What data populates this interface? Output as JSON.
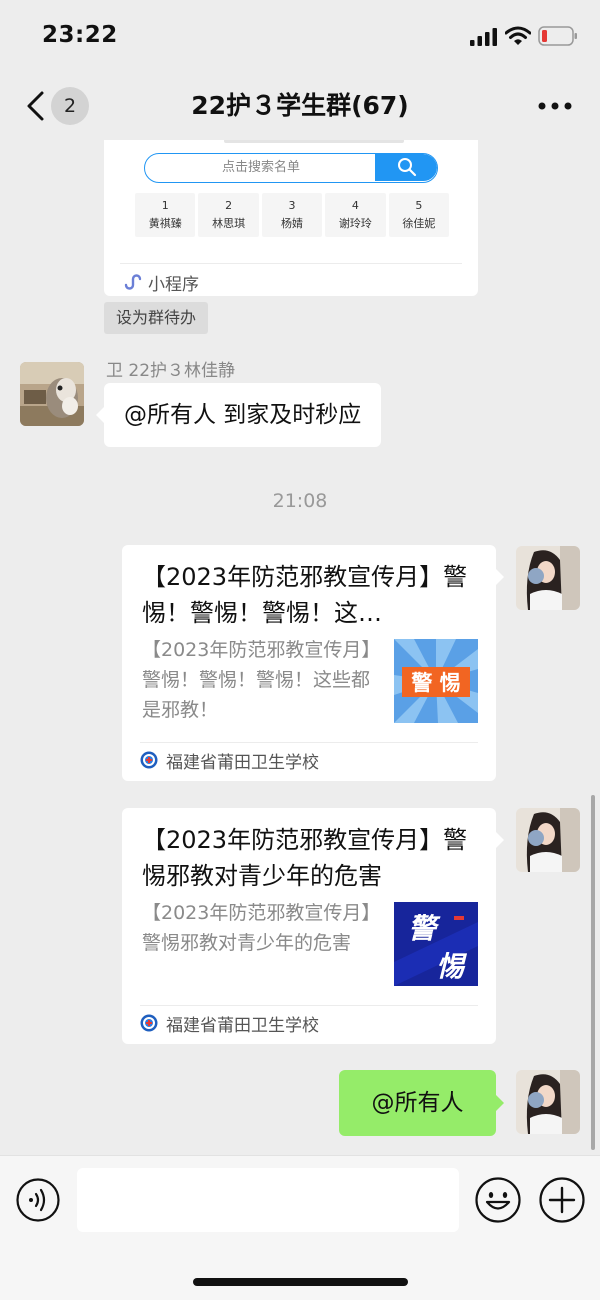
{
  "status_bar": {
    "time": "23:22"
  },
  "header": {
    "unread_count": "2",
    "title": "22护３学生群(67)"
  },
  "mini_program": {
    "search_placeholder": "点击搜索名单",
    "names": [
      {
        "index": "1",
        "name": "黄祺臻"
      },
      {
        "index": "2",
        "name": "林思琪"
      },
      {
        "index": "3",
        "name": "杨婧"
      },
      {
        "index": "4",
        "name": "谢玲玲"
      },
      {
        "index": "5",
        "name": "徐佳妮"
      }
    ],
    "footer_label": "小程序"
  },
  "todo_tag": "设为群待办",
  "incoming_message": {
    "sender": "卫 22护３林佳静",
    "text": "@所有人 到家及时秒应"
  },
  "time_divider": "21:08",
  "articles": [
    {
      "title": "【2023年防范邪教宣传月】警惕！警惕！警惕！这…",
      "desc": "【2023年防范邪教宣传月】警惕！警惕！警惕！这些都是邪教！",
      "thumb_text": "警 惕",
      "source": "福建省莆田卫生学校"
    },
    {
      "title": "【2023年防范邪教宣传月】警惕邪教对青少年的危害",
      "desc": "【2023年防范邪教宣传月】警惕邪教对青少年的危害",
      "thumb_text_1": "警",
      "thumb_text_2": "惕",
      "source": "福建省莆田卫生学校"
    }
  ],
  "outgoing_message": {
    "text": "@所有人"
  },
  "input": {
    "value": ""
  },
  "colors": {
    "background": "#ededed",
    "outgoing_bubble": "#95ec69",
    "search_blue": "#2196f3",
    "battery_low": "#e53935"
  }
}
